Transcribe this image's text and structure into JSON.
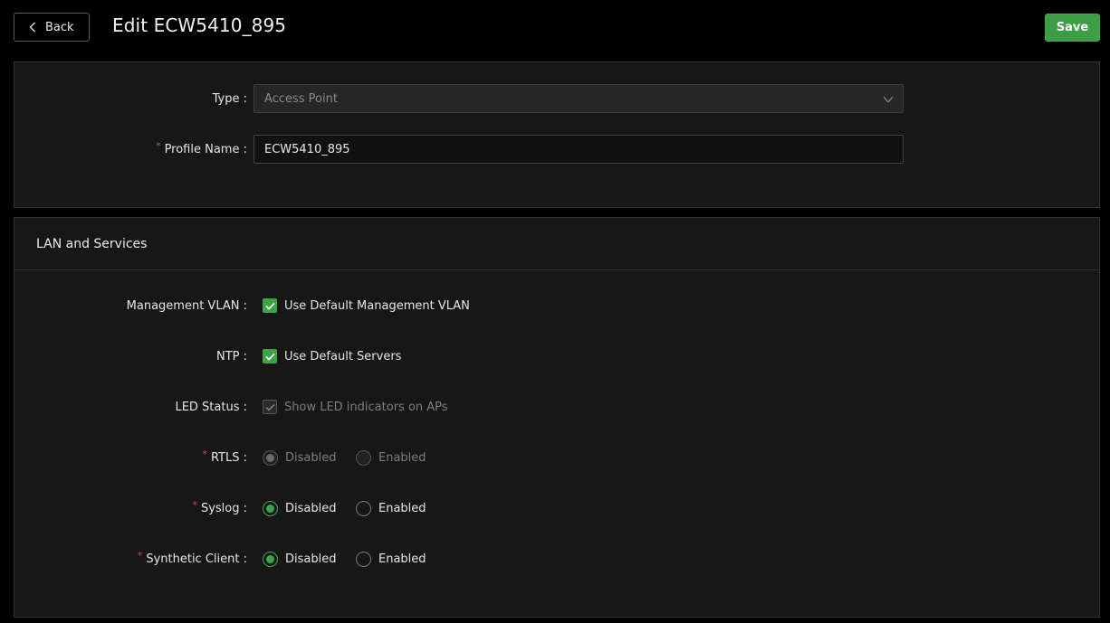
{
  "header": {
    "back_label": "Back",
    "title": "Edit ECW5410_895",
    "save_label": "Save"
  },
  "profile": {
    "type_label": "Type",
    "type_value": "Access Point",
    "name_label": "Profile Name",
    "name_value": "ECW5410_895"
  },
  "lan": {
    "section_title": "LAN and Services",
    "management_vlan": {
      "label": "Management VLAN",
      "option": "Use Default Management VLAN",
      "checked": true
    },
    "ntp": {
      "label": "NTP",
      "option": "Use Default Servers",
      "checked": true
    },
    "led_status": {
      "label": "LED Status",
      "option": "Show LED indicators on APs",
      "checked": true,
      "disabled": true
    },
    "rtls": {
      "label": "RTLS",
      "disabled_label": "Disabled",
      "enabled_label": "Enabled",
      "selected": "Disabled",
      "disabled": true
    },
    "syslog": {
      "label": "Syslog",
      "disabled_label": "Disabled",
      "enabled_label": "Enabled",
      "selected": "Disabled"
    },
    "synthetic_client": {
      "label": "Synthetic Client",
      "disabled_label": "Disabled",
      "enabled_label": "Enabled",
      "selected": "Disabled"
    }
  },
  "colors": {
    "accent": "#3ba548",
    "required": "#e04848",
    "panel": "#171717",
    "background": "#000000"
  }
}
